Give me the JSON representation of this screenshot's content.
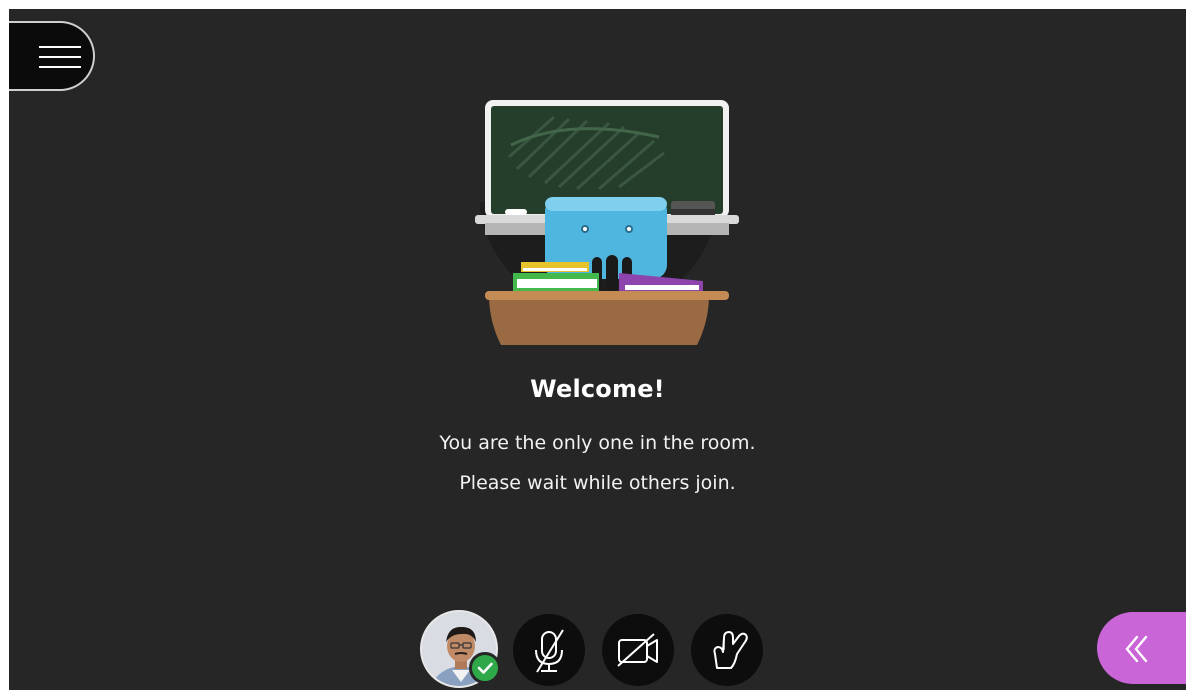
{
  "colors": {
    "background": "#262626",
    "accent_panel": "#c965d6",
    "status_ok": "#2fa84a",
    "button_bg": "#0d0d0d"
  },
  "welcome": {
    "title": "Welcome!",
    "line1": "You are the only one in the room.",
    "line2": "Please wait while others join."
  },
  "icons": {
    "menu": "hamburger-icon",
    "illustration": "classroom-illustration",
    "status": "checkmark-icon",
    "microphone": "microphone-off-icon",
    "camera": "camera-off-icon",
    "hand": "raise-hand-icon",
    "panel": "double-chevron-left-icon"
  }
}
